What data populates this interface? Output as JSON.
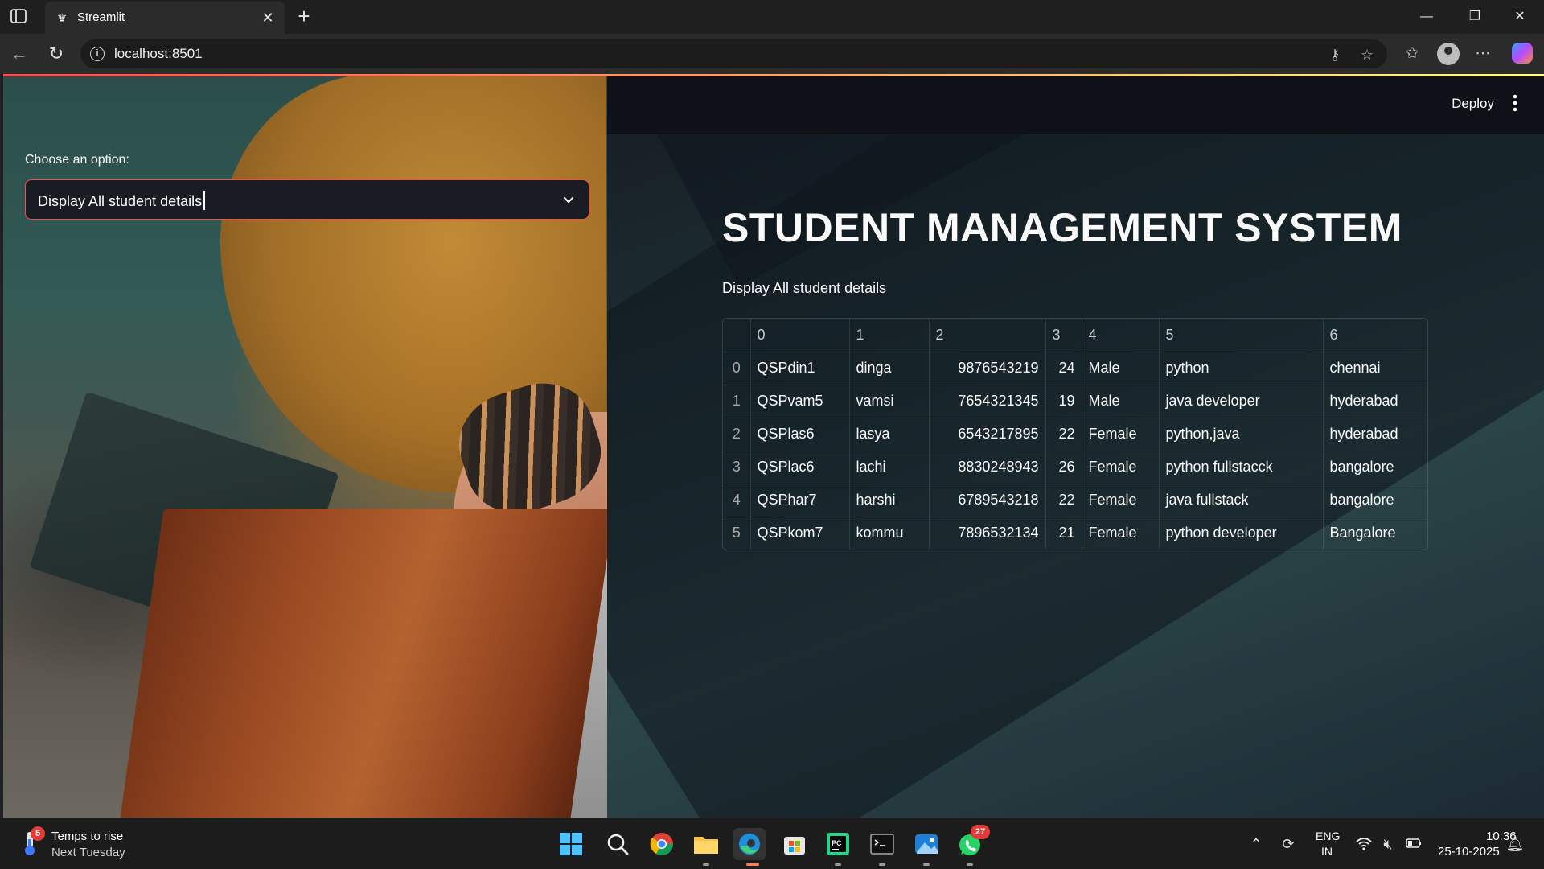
{
  "browser": {
    "tab_title": "Streamlit",
    "url": "localhost:8501"
  },
  "sidebar": {
    "label": "Choose an option:",
    "selected": "Display All student details"
  },
  "header": {
    "deploy_label": "Deploy"
  },
  "main": {
    "title": "STUDENT MANAGEMENT SYSTEM",
    "subtitle": "Display All student details",
    "table": {
      "columns": [
        "0",
        "1",
        "2",
        "3",
        "4",
        "5",
        "6"
      ],
      "rows": [
        {
          "index": "0",
          "cells": [
            "QSPdin1",
            "dinga",
            "9876543219",
            "24",
            "Male",
            "python",
            "chennai"
          ]
        },
        {
          "index": "1",
          "cells": [
            "QSPvam5",
            "vamsi",
            "7654321345",
            "19",
            "Male",
            "java developer",
            "hyderabad"
          ]
        },
        {
          "index": "2",
          "cells": [
            "QSPlas6",
            "lasya",
            "6543217895",
            "22",
            "Female",
            "python,java",
            "hyderabad"
          ]
        },
        {
          "index": "3",
          "cells": [
            "QSPlac6",
            "lachi",
            "8830248943",
            "26",
            "Female",
            "python fullstacck",
            "bangalore"
          ]
        },
        {
          "index": "4",
          "cells": [
            "QSPhar7",
            "harshi",
            "6789543218",
            "22",
            "Female",
            "java fullstack",
            "bangalore"
          ]
        },
        {
          "index": "5",
          "cells": [
            "QSPkom7",
            "kommu",
            "7896532134",
            "21",
            "Female",
            "python developer",
            "Bangalore"
          ]
        }
      ]
    }
  },
  "taskbar": {
    "weather_badge": "5",
    "weather_line1": "Temps to rise",
    "weather_line2": "Next Tuesday",
    "whatsapp_badge": "27",
    "lang_line1": "ENG",
    "lang_line2": "IN",
    "time": "10:36",
    "date": "25-10-2025"
  },
  "colors": {
    "accent": "#ff4b4b",
    "background": "#0e1117",
    "text": "#fafafa"
  }
}
